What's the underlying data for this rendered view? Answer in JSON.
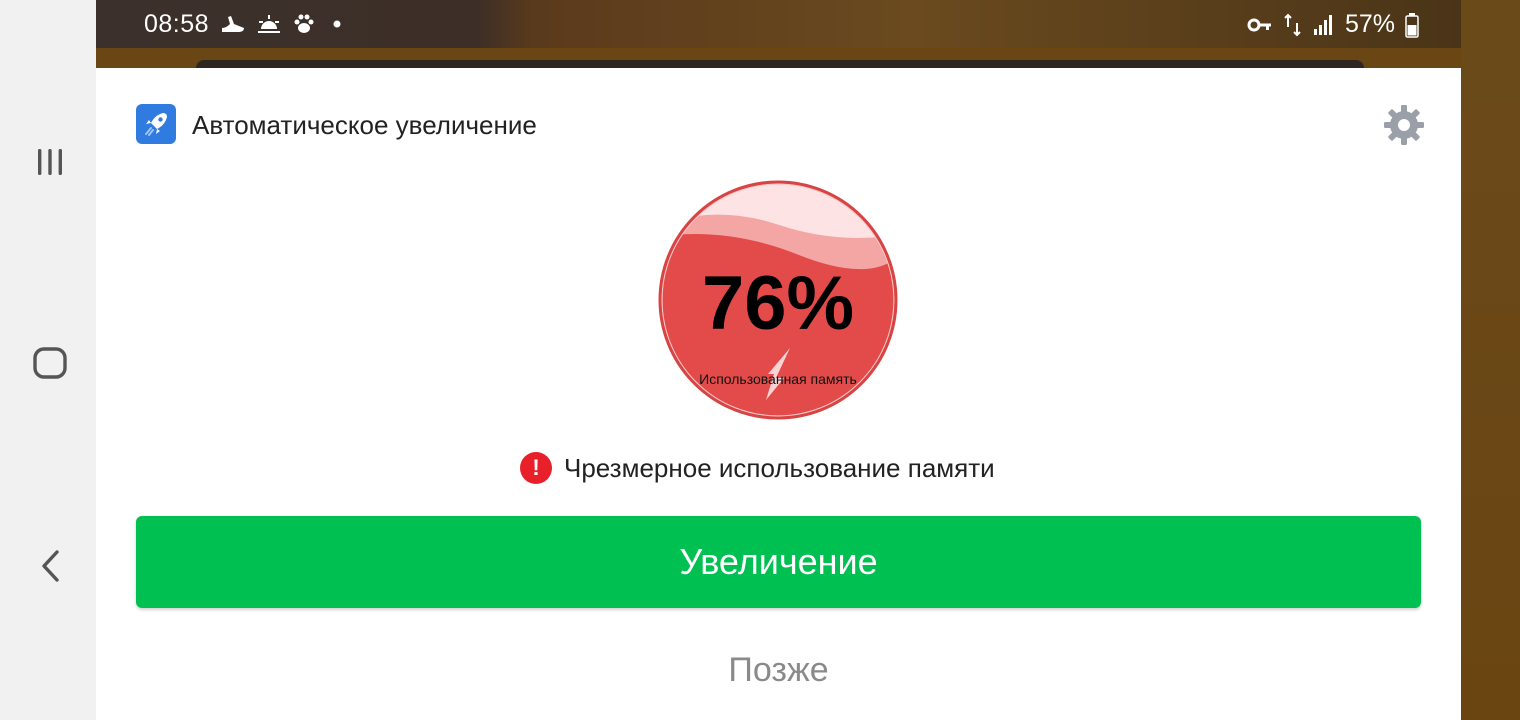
{
  "status_bar": {
    "time": "08:58",
    "battery_percent": "57%",
    "left_icons": [
      "running-shoe-icon",
      "sunrise-icon",
      "paw-icon",
      "dot-icon"
    ],
    "right_icons": [
      "key-icon",
      "data-arrows-icon",
      "signal-icon",
      "battery-icon"
    ]
  },
  "dialog": {
    "app_title": "Автоматическое увеличение",
    "app_icon": "rocket-icon",
    "settings_icon": "gear-icon",
    "memory_gauge": {
      "value_text": "76%",
      "fill_fraction": 0.76,
      "label": "Использованная память"
    },
    "warning": {
      "icon": "exclamation-icon",
      "text": "Чрезмерное использование памяти"
    },
    "primary_button_label": "Увеличение",
    "secondary_button_label": "Позже"
  },
  "navigation_bar": {
    "icons": [
      "recents-icon",
      "home-icon",
      "back-icon"
    ]
  },
  "colors": {
    "accent_green": "#00c052",
    "gauge_red": "#e24b4a",
    "warning_red": "#e8202a",
    "app_icon_blue": "#2f7be0"
  }
}
